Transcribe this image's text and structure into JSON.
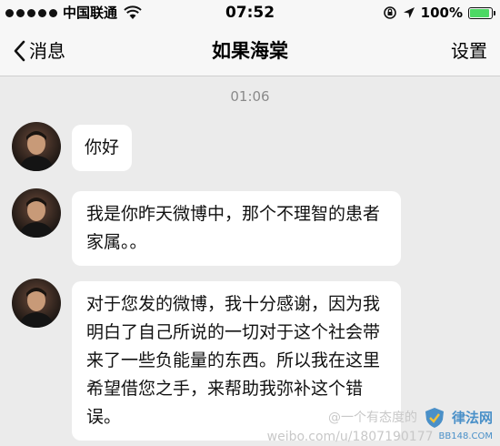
{
  "status_bar": {
    "carrier": "中国联通",
    "time": "07:52",
    "battery_percent": "100%"
  },
  "nav": {
    "back_label": "消息",
    "title": "如果海棠",
    "settings_label": "设置"
  },
  "chat": {
    "timestamp": "01:06",
    "messages": [
      {
        "text": "你好"
      },
      {
        "text": "我是你昨天微博中，那个不理智的患者家属。。"
      },
      {
        "text": "对于您发的微博，我十分感谢，因为我明白了自己所说的一切对于这个社会带来了一些负能量的东西。所以我在这里希望借您之手，来帮助我弥补这个错误。"
      }
    ]
  },
  "watermark": {
    "handle": "@一个有态度的",
    "url": "weibo.com/u/1807190177",
    "brand": "律法网",
    "brand_site": "BB148.COM"
  },
  "colors": {
    "battery": "#4cd964",
    "background": "#ebebeb",
    "bubble": "#ffffff",
    "nav_background": "#f7f7f7"
  }
}
